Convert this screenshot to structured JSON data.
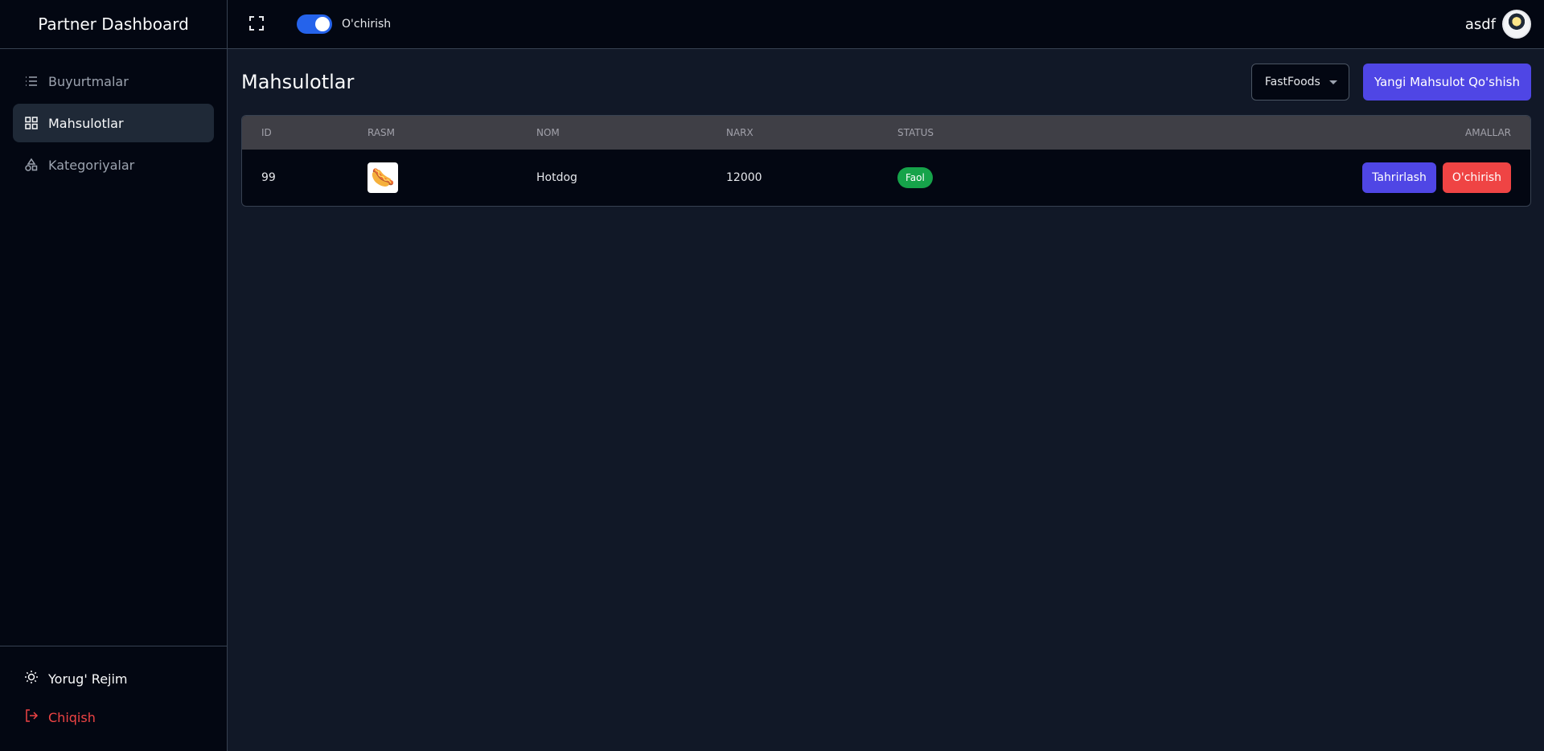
{
  "brand": "Partner Dashboard",
  "sidebar": {
    "items": [
      {
        "label": "Buyurtmalar",
        "icon": "list-icon"
      },
      {
        "label": "Mahsulotlar",
        "icon": "grid-icon"
      },
      {
        "label": "Kategoriyalar",
        "icon": "shapes-icon"
      }
    ],
    "theme_label": "Yorug' Rejim",
    "logout_label": "Chiqish"
  },
  "header": {
    "toggle_label": "O'chirish",
    "user_name": "asdf"
  },
  "main": {
    "title": "Mahsulotlar",
    "category_select": "FastFoods",
    "add_button": "Yangi Mahsulot Qo'shish"
  },
  "table": {
    "columns": [
      "ID",
      "RASM",
      "NOM",
      "NARX",
      "STATUS",
      "AMALLAR"
    ],
    "rows": [
      {
        "id": "99",
        "image": "🌭",
        "name": "Hotdog",
        "price": "12000",
        "status": "Faol",
        "edit": "Tahrirlash",
        "delete": "O'chirish"
      }
    ]
  },
  "colors": {
    "accent": "#4f46e5",
    "danger": "#ef4444",
    "success": "#16a34a",
    "toggle": "#2563eb"
  }
}
